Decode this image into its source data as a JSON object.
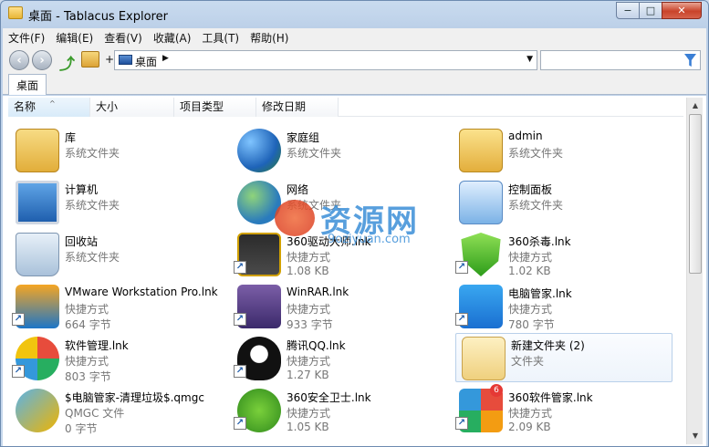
{
  "window": {
    "title": "桌面 - Tablacus Explorer",
    "buttons": {
      "minimize": "−",
      "maximize": "□",
      "close": "✕"
    }
  },
  "menubar": {
    "items": [
      "文件(F)",
      "编辑(E)",
      "查看(V)",
      "收藏(A)",
      "工具(T)",
      "帮助(H)"
    ]
  },
  "toolbar": {
    "back": "‹",
    "forward": "›",
    "up_glyph": "⤴",
    "plus": "+",
    "address_text": "桌面",
    "address_arrow": "▶",
    "dropdown_arrow": "▼",
    "search_value": ""
  },
  "tabs": [
    {
      "label": "桌面"
    }
  ],
  "columns": {
    "name": "名称",
    "size": "大小",
    "type": "项目类型",
    "date": "修改日期",
    "sort_indicator": "^"
  },
  "scrollbar": {
    "up": "▲",
    "down": "▼"
  },
  "items": [
    {
      "name": "库",
      "line1": "系统文件夹",
      "line2": ""
    },
    {
      "name": "家庭组",
      "line1": "系统文件夹",
      "line2": ""
    },
    {
      "name": "admin",
      "line1": "系统文件夹",
      "line2": ""
    },
    {
      "name": "计算机",
      "line1": "系统文件夹",
      "line2": ""
    },
    {
      "name": "网络",
      "line1": "系统文件夹",
      "line2": ""
    },
    {
      "name": "控制面板",
      "line1": "系统文件夹",
      "line2": ""
    },
    {
      "name": "回收站",
      "line1": "系统文件夹",
      "line2": ""
    },
    {
      "name": "360驱动大师.lnk",
      "line1": "快捷方式",
      "line2": "1.08 KB"
    },
    {
      "name": "360杀毒.lnk",
      "line1": "快捷方式",
      "line2": "1.02 KB"
    },
    {
      "name": "VMware Workstation Pro.lnk",
      "line1": "快捷方式",
      "line2": "664 字节"
    },
    {
      "name": "WinRAR.lnk",
      "line1": "快捷方式",
      "line2": "933 字节"
    },
    {
      "name": "电脑管家.lnk",
      "line1": "快捷方式",
      "line2": "780 字节"
    },
    {
      "name": "软件管理.lnk",
      "line1": "快捷方式",
      "line2": "803 字节"
    },
    {
      "name": "腾讯QQ.lnk",
      "line1": "快捷方式",
      "line2": "1.27 KB"
    },
    {
      "name": "新建文件夹 (2)",
      "line1": "文件夹",
      "line2": ""
    },
    {
      "name": "$电脑管家-清理垃圾$.qmgc",
      "line1": "QMGC 文件",
      "line2": "0 字节"
    },
    {
      "name": "360安全卫士.lnk",
      "line1": "快捷方式",
      "line2": "1.05 KB"
    },
    {
      "name": "360软件管家.lnk",
      "line1": "快捷方式",
      "line2": "2.09 KB"
    }
  ],
  "badge_360soft": "6",
  "shortcut_glyph": "↗",
  "watermark": {
    "text": "资源网",
    "sub": "9oziyuan.com"
  }
}
